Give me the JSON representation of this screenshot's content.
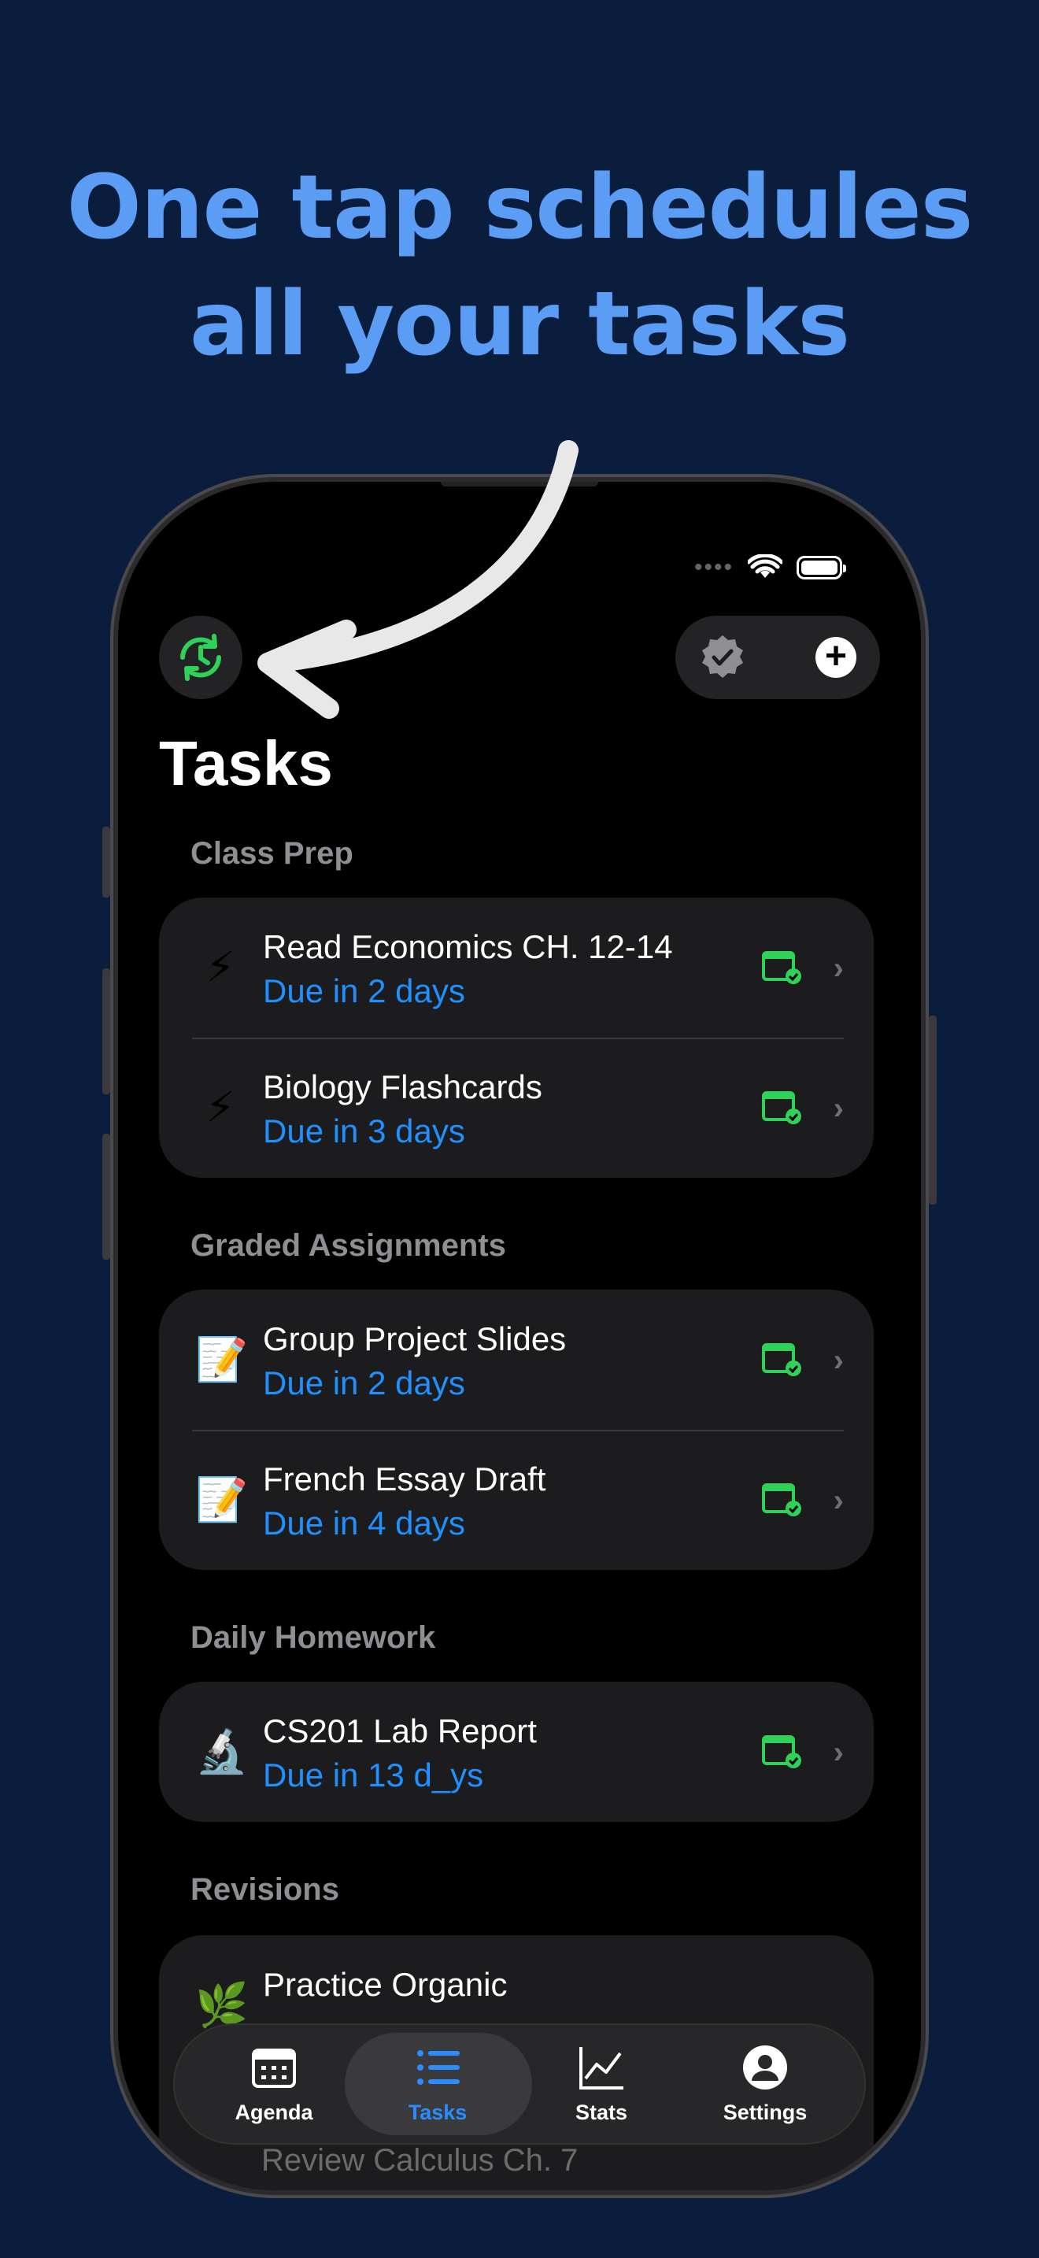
{
  "headline": [
    "One tap schedules",
    "all your tasks"
  ],
  "page_title": "Tasks",
  "status_bar": {
    "icons": [
      "signal-dots-icon",
      "wifi-icon",
      "battery-icon"
    ]
  },
  "toolbar": {
    "left": "sync-schedule-icon",
    "right": [
      "verified-badge-icon",
      "plus-icon"
    ]
  },
  "sections": [
    {
      "label": "Class Prep",
      "tasks": [
        {
          "emoji": "⚡",
          "name": "Read Economics CH. 12-14",
          "due": "Due in 2 days"
        },
        {
          "emoji": "⚡",
          "name": "Biology Flashcards",
          "due": "Due in 3 days"
        }
      ]
    },
    {
      "label": "Graded Assignments",
      "tasks": [
        {
          "emoji": "📝",
          "name": "Group Project Slides",
          "due": "Due in 2 days"
        },
        {
          "emoji": "📝",
          "name": "French Essay Draft",
          "due": "Due in 4 days"
        }
      ]
    },
    {
      "label": "Daily Homework",
      "tasks": [
        {
          "emoji": "🔬",
          "name": "CS201 Lab Report",
          "due": "Due in 13 d_ys"
        }
      ]
    },
    {
      "label": "Revisions",
      "tasks": [
        {
          "emoji": "🌿",
          "name": "Practice Organic",
          "due": ""
        }
      ]
    }
  ],
  "partially_hidden_task": "Review Calculus Ch. 7",
  "tabs": [
    {
      "label": "Agenda",
      "icon": "calendar-icon",
      "active": false
    },
    {
      "label": "Tasks",
      "icon": "list-icon",
      "active": true
    },
    {
      "label": "Stats",
      "icon": "chart-icon",
      "active": false
    },
    {
      "label": "Settings",
      "icon": "person-icon",
      "active": false
    }
  ],
  "colors": {
    "background": "#0b1d3d",
    "headline": "#5b9cf5",
    "accent": "#1e90ff",
    "calendar": "#30d158"
  }
}
